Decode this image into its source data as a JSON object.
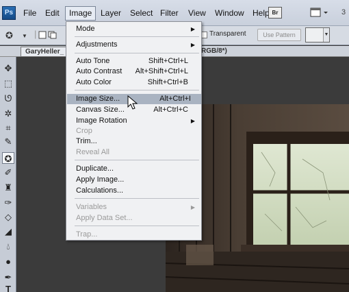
{
  "menubar": {
    "logo": "Ps",
    "items": [
      "File",
      "Edit",
      "Image",
      "Layer",
      "Select",
      "Filter",
      "View",
      "Window",
      "Help"
    ],
    "br_label": "Br",
    "right_number": "3"
  },
  "options": {
    "transparent_label": "Transparent",
    "use_pattern_label": "Use Pattern"
  },
  "tab": {
    "doc_name": "GaryHeller_",
    "mode": "RGB/8*)"
  },
  "image_menu": {
    "items": [
      {
        "label": "Mode",
        "shortcut": "",
        "submenu": true,
        "disabled": false
      },
      {
        "label": "Adjustments",
        "shortcut": "",
        "submenu": true,
        "disabled": false
      },
      {
        "label": "Auto Tone",
        "shortcut": "Shift+Ctrl+L",
        "submenu": false,
        "disabled": false
      },
      {
        "label": "Auto Contrast",
        "shortcut": "Alt+Shift+Ctrl+L",
        "submenu": false,
        "disabled": false
      },
      {
        "label": "Auto Color",
        "shortcut": "Shift+Ctrl+B",
        "submenu": false,
        "disabled": false
      },
      {
        "label": "Image Size...",
        "shortcut": "Alt+Ctrl+I",
        "submenu": false,
        "disabled": false,
        "highlight": true
      },
      {
        "label": "Canvas Size...",
        "shortcut": "Alt+Ctrl+C",
        "submenu": false,
        "disabled": false
      },
      {
        "label": "Image Rotation",
        "shortcut": "",
        "submenu": true,
        "disabled": false
      },
      {
        "label": "Crop",
        "shortcut": "",
        "submenu": false,
        "disabled": true
      },
      {
        "label": "Trim...",
        "shortcut": "",
        "submenu": false,
        "disabled": false
      },
      {
        "label": "Reveal All",
        "shortcut": "",
        "submenu": false,
        "disabled": true
      },
      {
        "label": "Duplicate...",
        "shortcut": "",
        "submenu": false,
        "disabled": false
      },
      {
        "label": "Apply Image...",
        "shortcut": "",
        "submenu": false,
        "disabled": false
      },
      {
        "label": "Calculations...",
        "shortcut": "",
        "submenu": false,
        "disabled": false
      },
      {
        "label": "Variables",
        "shortcut": "",
        "submenu": true,
        "disabled": true
      },
      {
        "label": "Apply Data Set...",
        "shortcut": "",
        "submenu": false,
        "disabled": true
      },
      {
        "label": "Trap...",
        "shortcut": "",
        "submenu": false,
        "disabled": true
      }
    ]
  },
  "tools": [
    "move-tool",
    "marquee-tool",
    "lasso-tool",
    "magic-wand-tool",
    "crop-tool",
    "eyedropper-tool",
    "healing-brush-tool",
    "brush-tool",
    "clone-stamp-tool",
    "history-brush-tool",
    "eraser-tool",
    "paint-bucket-tool",
    "blur-tool",
    "dodge-tool",
    "pen-tool",
    "type-tool"
  ],
  "colors": {
    "menubar": "#d7dde8",
    "menu_highlight": "#a9b3c1",
    "canvas": "#3b3b3b"
  }
}
